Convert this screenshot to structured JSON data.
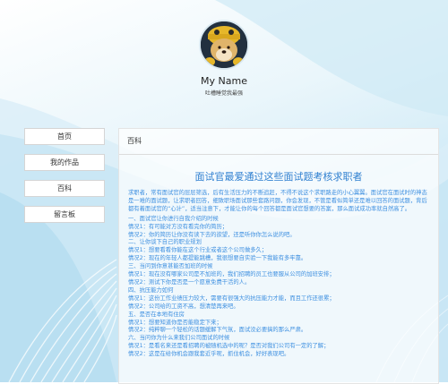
{
  "profile": {
    "name": "My Name",
    "motto": "吐槽睡觉我最强"
  },
  "nav": {
    "items": [
      "首页",
      "我的作品",
      "百科",
      "留言板"
    ]
  },
  "panel": {
    "header": "百科",
    "article_title": "面试官最爱通过这些面试题考核求职者",
    "intro": "求职者，常有面试官的层层筛选，后有生活压力的不断追赶，不得不说这个求职路走的小心翼翼。面试官在面试时的神态是一难的面试题，让求职者回答，细致职场面试那些套路问题，你会发现，不管是看似简单还是难以回答的面试题，背后都有着面试官的“心计”，适当注意下，才能让你的每个回答都是面试官想要的答案，那么面试成功率就自然高了。",
    "lines": [
      "一、面试官让你进行自我介绍的时候",
      "情况1：有可能对方没有看完你的简历；",
      "情况2：你的简历让你没有读下去的欲望，还是听你你怎么说的吧。",
      "二、让你谈下自己的职业规划",
      "情况1：想要看看你能在这个行业或者这个公司做多久；",
      "情况2：现在的年轻人都提能跳槽，我很想要自实验一下我能有多牢靠。",
      "三、当问到你意甚能否加班的时候",
      "情况1：现在没有哪家公司是不加班的，我们招聘的员工也要服从公司的加班安排；",
      "情况2：测试下你是否是一个愿意免费干活的人。",
      "四、抗压能力如何",
      "情况1：这份工作业绩压力较大，需要有很强大的抗压能力才能，而且工作还很累；",
      "情况2：公司给的工资不高，想清楚再来吧。",
      "五、是否在本地有住房",
      "情况1：想要知道你是否能稳定下来；",
      "情况2：纯粹聊一个轻松的话题缓解下气氛，面试没必要搞的那么严肃。",
      "六、当问你为什么来我们公司面试的时候",
      "情况1：是看名来还是看招聘的被随机选中的呢？是否对我们公司有一定的了解；",
      "情况2：这是在给你机会跟我套近乎呢，抓住机会，好好表现吧。"
    ]
  }
}
